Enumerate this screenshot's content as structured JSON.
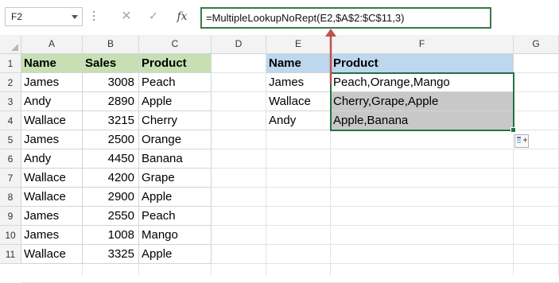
{
  "name_box": {
    "value": "F2"
  },
  "formula_bar": {
    "cancel_icon": "close-icon",
    "enter_icon": "check-icon",
    "insert_function_label": "fx",
    "formula": "=MultipleLookupNoRept(E2,$A$2:$C$11,3)"
  },
  "columns": [
    "A",
    "B",
    "C",
    "D",
    "E",
    "F",
    "G"
  ],
  "rows": [
    "1",
    "2",
    "3",
    "4",
    "5",
    "6",
    "7",
    "8",
    "9",
    "10",
    "11"
  ],
  "source_table": {
    "headers": [
      "Name",
      "Sales",
      "Product"
    ],
    "rows": [
      [
        "James",
        "3008",
        "Peach"
      ],
      [
        "Andy",
        "2890",
        "Apple"
      ],
      [
        "Wallace",
        "3215",
        "Cherry"
      ],
      [
        "James",
        "2500",
        "Orange"
      ],
      [
        "Andy",
        "4450",
        "Banana"
      ],
      [
        "Wallace",
        "4200",
        "Grape"
      ],
      [
        "Wallace",
        "2900",
        "Apple"
      ],
      [
        "James",
        "2550",
        "Peach"
      ],
      [
        "James",
        "1008",
        "Mango"
      ],
      [
        "Wallace",
        "3325",
        "Apple"
      ]
    ]
  },
  "result_table": {
    "headers": [
      "Name",
      "Product"
    ],
    "rows": [
      [
        "James",
        "Peach,Orange,Mango"
      ],
      [
        "Wallace",
        "Cherry,Grape,Apple"
      ],
      [
        "Andy",
        "Apple,Banana"
      ]
    ]
  },
  "colors": {
    "source_header_fill": "#c6e0b4",
    "result_header_fill": "#bdd7ee",
    "selected_fill": "#c8c8c8",
    "selection_border": "#217346",
    "annotation_arrow": "#c0504d"
  }
}
